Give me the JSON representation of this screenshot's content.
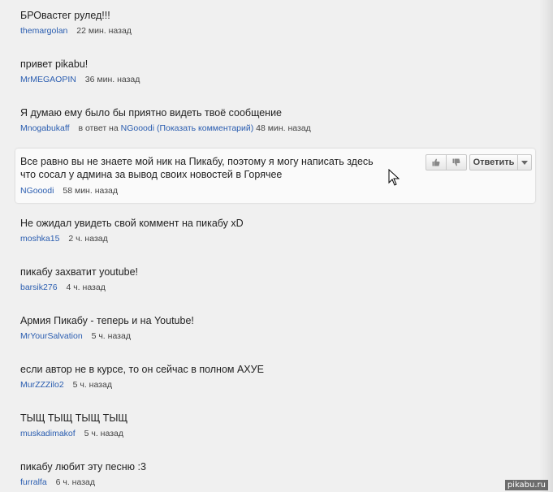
{
  "comments": [
    {
      "text": "БРОвастег рулед!!!",
      "author": "themargolan",
      "time": "22 мин. назад"
    },
    {
      "text": "привет pikabu!",
      "author": "MrMEGAOPIN",
      "time": "36 мин. назад"
    },
    {
      "text": "Я думаю ему было бы приятно видеть твоё сообщение",
      "author": "Mnogabukaff",
      "reply_prefix": "в ответ на",
      "reply_link": "NGooodi (Показать комментарий)",
      "time": "48 мин. назад"
    },
    {
      "text": "Все равно вы не знаете мой ник на Пикабу, поэтому я могу написать здесь что сосал у админа за вывод своих новостей в Горячее",
      "author": "NGooodi",
      "time": "58 мин. назад"
    },
    {
      "text": "Не ожидал увидеть свой коммент на пикабу xD",
      "author": "moshka15",
      "time": "2 ч. назад"
    },
    {
      "text": "пикабу захватит youtube!",
      "author": "barsik276",
      "time": "4 ч. назад"
    },
    {
      "text": "Армия Пикабу - теперь и на Youtube!",
      "author": "MrYourSalvation",
      "time": "5 ч. назад"
    },
    {
      "text": "если автор не в курсе, то он сейчас в полном АХУЕ",
      "author": "MurZZZilo2",
      "time": "5 ч. назад"
    },
    {
      "text": "ТЫЩ ТЫЩ ТЫЩ ТЫЩ",
      "author": "muskadimakof",
      "time": "5 ч. назад"
    },
    {
      "text": "пикабу любит эту песню :3",
      "author": "furralfa",
      "time": "6 ч. назад"
    }
  ],
  "actions": {
    "like_icon": "thumbs-up-icon",
    "dislike_icon": "thumbs-down-icon",
    "reply_label": "Ответить",
    "more_icon": "dropdown-arrow-icon"
  },
  "watermark": "pikabu.ru",
  "colors": {
    "link": "#2a5db0",
    "text": "#222222",
    "background": "#f0f0f0"
  }
}
